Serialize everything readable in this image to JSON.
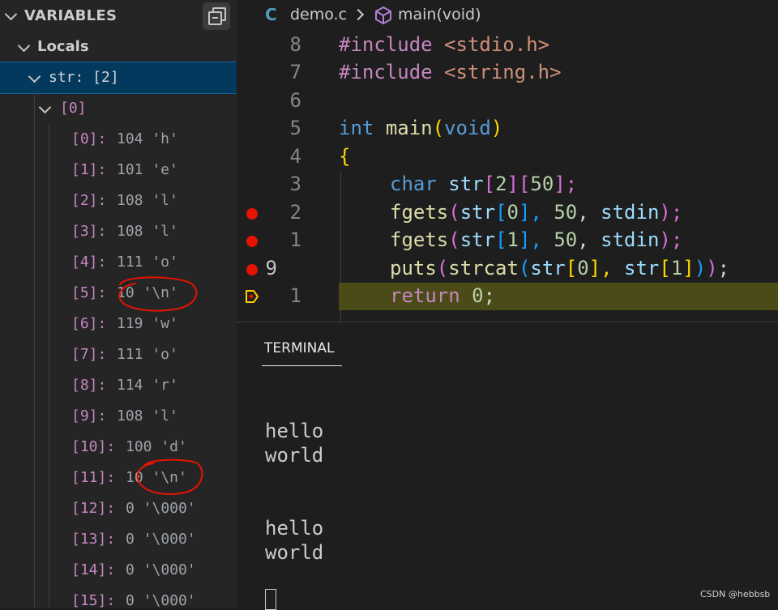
{
  "sidebar": {
    "title": "VARIABLES",
    "locals_label": "Locals",
    "str_node": "str: [2]",
    "index_node": "[0]",
    "items": [
      {
        "idx": "[0]:",
        "val": "104 'h'"
      },
      {
        "idx": "[1]:",
        "val": "101 'e'"
      },
      {
        "idx": "[2]:",
        "val": "108 'l'"
      },
      {
        "idx": "[3]:",
        "val": "108 'l'"
      },
      {
        "idx": "[4]:",
        "val": "111 'o'"
      },
      {
        "idx": "[5]:",
        "val": "10 '\\n'"
      },
      {
        "idx": "[6]:",
        "val": "119 'w'"
      },
      {
        "idx": "[7]:",
        "val": "111 'o'"
      },
      {
        "idx": "[8]:",
        "val": "114 'r'"
      },
      {
        "idx": "[9]:",
        "val": "108 'l'"
      },
      {
        "idx": "[10]:",
        "val": "100 'd'"
      },
      {
        "idx": "[11]:",
        "val": "10 '\\n'"
      },
      {
        "idx": "[12]:",
        "val": "0 '\\000'"
      },
      {
        "idx": "[13]:",
        "val": "0 '\\000'"
      },
      {
        "idx": "[14]:",
        "val": "0 '\\000'"
      },
      {
        "idx": "[15]:",
        "val": "0 '\\000'"
      }
    ]
  },
  "editor": {
    "breadcrumb": {
      "lang_icon": "C",
      "file": "demo.c",
      "func": "main(void)"
    },
    "line_numbers": [
      "8",
      "7",
      "6",
      "5",
      "4",
      "3",
      "2",
      "1",
      "9",
      "1"
    ],
    "code": {
      "l0a": "#include",
      "l0b": "<stdio.h>",
      "l1a": "#include",
      "l1b": "<string.h>",
      "l3a": "int",
      "l3b": "main",
      "l3c": "(",
      "l3d": "void",
      "l3e": ")",
      "l4a": "{",
      "l5a": "char",
      "l5b": "str",
      "l5c": "[",
      "l5d": "2",
      "l5e": "][",
      "l5f": "50",
      "l5g": "];",
      "l6a": "fgets",
      "l6b": "(",
      "l6c": "str",
      "l6d": "[",
      "l6e": "0",
      "l6f": "], ",
      "l6g": "50",
      "l6h": ", ",
      "l6i": "stdin",
      "l6j": ");",
      "l7a": "fgets",
      "l7b": "(",
      "l7c": "str",
      "l7d": "[",
      "l7e": "1",
      "l7f": "], ",
      "l7g": "50",
      "l7h": ", ",
      "l7i": "stdin",
      "l7j": ");",
      "l8a": "puts",
      "l8b": "(",
      "l8c": "strcat",
      "l8d": "(",
      "l8e": "str",
      "l8f": "[",
      "l8g": "0",
      "l8h": "], ",
      "l8i": "str",
      "l8j": "[",
      "l8k": "1",
      "l8l": "]",
      "l8m": ")",
      "l8n": ")",
      "l8o": ";",
      "l9a": "return",
      "l9b": "0",
      "l9c": ";"
    }
  },
  "panel": {
    "tab_label": "TERMINAL",
    "lines": [
      "hello",
      "world",
      "hello",
      "world"
    ]
  },
  "watermark": "CSDN @hebbsb",
  "colors": {
    "breakpoint": "#e51400",
    "current_line": "#4b4b18",
    "selection": "#04395e",
    "annotation": "#e51400"
  }
}
